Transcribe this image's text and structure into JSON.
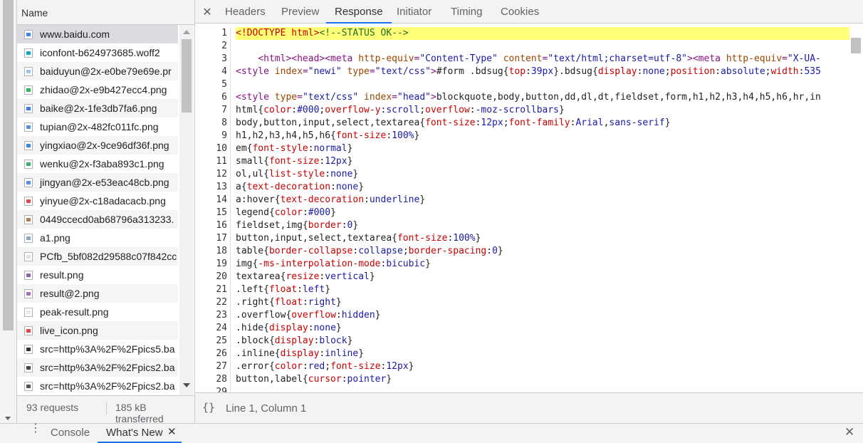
{
  "network": {
    "header": "Name",
    "rows": [
      {
        "name": "www.baidu.com",
        "icon": "document-icon",
        "color": "#4285f4",
        "bg": "sel"
      },
      {
        "name": "iconfont-b624973685.woff2",
        "icon": "font-icon",
        "color": "#12a5c4",
        "bg": ""
      },
      {
        "name": "baiduyun@2x-e0be79e69e.pr",
        "icon": "image-icon",
        "color": "#9dc3ea",
        "bg": "alt"
      },
      {
        "name": "zhidao@2x-e9b427ecc4.png",
        "icon": "image-icon",
        "color": "#2fb75b",
        "bg": ""
      },
      {
        "name": "baike@2x-1fe3db7fa6.png",
        "icon": "image-icon",
        "color": "#3c7dea",
        "bg": "alt"
      },
      {
        "name": "tupian@2x-482fc011fc.png",
        "icon": "image-icon",
        "color": "#5a8ed8",
        "bg": ""
      },
      {
        "name": "yingxiao@2x-9ce96df36f.png",
        "icon": "image-icon",
        "color": "#3d84f0",
        "bg": "alt"
      },
      {
        "name": "wenku@2x-f3aba893c1.png",
        "icon": "image-icon",
        "color": "#3fae68",
        "bg": ""
      },
      {
        "name": "jingyan@2x-e53eac48cb.png",
        "icon": "image-icon",
        "color": "#5b8fe5",
        "bg": "alt"
      },
      {
        "name": "yinyue@2x-c18adacacb.png",
        "icon": "image-icon",
        "color": "#e5484d",
        "bg": ""
      },
      {
        "name": "0449ccecd0ab68796a313233.",
        "icon": "image-icon",
        "color": "#b07c5a",
        "bg": "alt"
      },
      {
        "name": "a1.png",
        "icon": "image-icon",
        "color": "#8aa5c9",
        "bg": ""
      },
      {
        "name": "PCfb_5bf082d29588c07f842cc",
        "icon": "image-icon",
        "color": "#dfe3e8",
        "bg": "alt"
      },
      {
        "name": "result.png",
        "icon": "image-icon",
        "color": "#8c6aa8",
        "bg": ""
      },
      {
        "name": "result@2.png",
        "icon": "image-icon",
        "color": "#a574b8",
        "bg": "alt"
      },
      {
        "name": "peak-result.png",
        "icon": "image-icon",
        "color": "#e8e8e8",
        "bg": ""
      },
      {
        "name": "live_icon.png",
        "icon": "image-icon",
        "color": "#e54545",
        "bg": "alt"
      },
      {
        "name": "src=http%3A%2F%2Fpics5.ba",
        "icon": "image-icon",
        "color": "#333333",
        "bg": ""
      },
      {
        "name": "src=http%3A%2F%2Fpics2.ba",
        "icon": "image-icon",
        "color": "#444444",
        "bg": "alt"
      },
      {
        "name": "src=http%3A%2F%2Fpics2.ba",
        "icon": "image-icon",
        "color": "#555555",
        "bg": ""
      }
    ],
    "footer_requests": "93 requests",
    "footer_transferred": "185 kB transferred"
  },
  "tabs": [
    "Headers",
    "Preview",
    "Response",
    "Initiator",
    "Timing",
    "Cookies"
  ],
  "active_tab": "Response",
  "code_lines": [
    [
      [
        "dt",
        "<!DOCTYPE html>"
      ],
      [
        "cm",
        "<!--STATUS OK-->"
      ]
    ],
    [],
    [
      [
        "pl",
        "    "
      ],
      [
        "tg",
        "<html><head><meta "
      ],
      [
        "at",
        "http-equiv"
      ],
      [
        "tg",
        "="
      ],
      [
        "av",
        "\"Content-Type\""
      ],
      [
        "tg",
        " "
      ],
      [
        "at",
        "content"
      ],
      [
        "tg",
        "="
      ],
      [
        "av",
        "\"text/html;charset=utf-8\""
      ],
      [
        "tg",
        "><meta "
      ],
      [
        "at",
        "http-equiv"
      ],
      [
        "tg",
        "="
      ],
      [
        "av",
        "\"X-UA-"
      ]
    ],
    [
      [
        "tg",
        "<style "
      ],
      [
        "at",
        "index"
      ],
      [
        "tg",
        "="
      ],
      [
        "av",
        "\"newi\""
      ],
      [
        "tg",
        " "
      ],
      [
        "at",
        "type"
      ],
      [
        "tg",
        "="
      ],
      [
        "av",
        "\"text/css\""
      ],
      [
        "tg",
        ">"
      ],
      [
        "pl",
        "#form .bdsug{"
      ],
      [
        "pr",
        "top"
      ],
      [
        "pl",
        ":"
      ],
      [
        "vl",
        "39px"
      ],
      [
        "pl",
        "}.bdsug{"
      ],
      [
        "pr",
        "display"
      ],
      [
        "pl",
        ":"
      ],
      [
        "vl",
        "none"
      ],
      [
        "pl",
        ";"
      ],
      [
        "pr",
        "position"
      ],
      [
        "pl",
        ":"
      ],
      [
        "vl",
        "absolute"
      ],
      [
        "pl",
        ";"
      ],
      [
        "pr",
        "width"
      ],
      [
        "pl",
        ":"
      ],
      [
        "vl",
        "535"
      ]
    ],
    [],
    [
      [
        "tg",
        "<style "
      ],
      [
        "at",
        "type"
      ],
      [
        "tg",
        "="
      ],
      [
        "av",
        "\"text/css\""
      ],
      [
        "tg",
        " "
      ],
      [
        "at",
        "index"
      ],
      [
        "tg",
        "="
      ],
      [
        "av",
        "\"head\""
      ],
      [
        "tg",
        ">"
      ],
      [
        "pl",
        "blockquote,body,button,dd,dl,dt,fieldset,form,h1,h2,h3,h4,h5,h6,hr,in"
      ]
    ],
    [
      [
        "pl",
        "html{"
      ],
      [
        "pr",
        "color"
      ],
      [
        "pl",
        ":"
      ],
      [
        "vl",
        "#000"
      ],
      [
        "pl",
        ";"
      ],
      [
        "pr",
        "overflow-y"
      ],
      [
        "pl",
        ":"
      ],
      [
        "vl",
        "scroll"
      ],
      [
        "pl",
        ";"
      ],
      [
        "pr",
        "overflow"
      ],
      [
        "pl",
        ":"
      ],
      [
        "vl",
        "-moz-scrollbars"
      ],
      [
        "pl",
        "}"
      ]
    ],
    [
      [
        "pl",
        "body,button,input,select,textarea{"
      ],
      [
        "pr",
        "font-size"
      ],
      [
        "pl",
        ":"
      ],
      [
        "vl",
        "12px"
      ],
      [
        "pl",
        ";"
      ],
      [
        "pr",
        "font-family"
      ],
      [
        "pl",
        ":"
      ],
      [
        "vl",
        "Arial"
      ],
      [
        "pl",
        ","
      ],
      [
        "vl",
        "sans-serif"
      ],
      [
        "pl",
        "}"
      ]
    ],
    [
      [
        "pl",
        "h1,h2,h3,h4,h5,h6{"
      ],
      [
        "pr",
        "font-size"
      ],
      [
        "pl",
        ":"
      ],
      [
        "vl",
        "100%"
      ],
      [
        "pl",
        "}"
      ]
    ],
    [
      [
        "pl",
        "em{"
      ],
      [
        "pr",
        "font-style"
      ],
      [
        "pl",
        ":"
      ],
      [
        "vl",
        "normal"
      ],
      [
        "pl",
        "}"
      ]
    ],
    [
      [
        "pl",
        "small{"
      ],
      [
        "pr",
        "font-size"
      ],
      [
        "pl",
        ":"
      ],
      [
        "vl",
        "12px"
      ],
      [
        "pl",
        "}"
      ]
    ],
    [
      [
        "pl",
        "ol,ul{"
      ],
      [
        "pr",
        "list-style"
      ],
      [
        "pl",
        ":"
      ],
      [
        "vl",
        "none"
      ],
      [
        "pl",
        "}"
      ]
    ],
    [
      [
        "pl",
        "a{"
      ],
      [
        "pr",
        "text-decoration"
      ],
      [
        "pl",
        ":"
      ],
      [
        "vl",
        "none"
      ],
      [
        "pl",
        "}"
      ]
    ],
    [
      [
        "pl",
        "a:hover{"
      ],
      [
        "pr",
        "text-decoration"
      ],
      [
        "pl",
        ":"
      ],
      [
        "vl",
        "underline"
      ],
      [
        "pl",
        "}"
      ]
    ],
    [
      [
        "pl",
        "legend{"
      ],
      [
        "pr",
        "color"
      ],
      [
        "pl",
        ":"
      ],
      [
        "vl",
        "#000"
      ],
      [
        "pl",
        "}"
      ]
    ],
    [
      [
        "pl",
        "fieldset,img{"
      ],
      [
        "pr",
        "border"
      ],
      [
        "pl",
        ":"
      ],
      [
        "vl",
        "0"
      ],
      [
        "pl",
        "}"
      ]
    ],
    [
      [
        "pl",
        "button,input,select,textarea{"
      ],
      [
        "pr",
        "font-size"
      ],
      [
        "pl",
        ":"
      ],
      [
        "vl",
        "100%"
      ],
      [
        "pl",
        "}"
      ]
    ],
    [
      [
        "pl",
        "table{"
      ],
      [
        "pr",
        "border-collapse"
      ],
      [
        "pl",
        ":"
      ],
      [
        "vl",
        "collapse"
      ],
      [
        "pl",
        ";"
      ],
      [
        "pr",
        "border-spacing"
      ],
      [
        "pl",
        ":"
      ],
      [
        "vl",
        "0"
      ],
      [
        "pl",
        "}"
      ]
    ],
    [
      [
        "pl",
        "img{"
      ],
      [
        "pr",
        "-ms-interpolation-mode"
      ],
      [
        "pl",
        ":"
      ],
      [
        "vl",
        "bicubic"
      ],
      [
        "pl",
        "}"
      ]
    ],
    [
      [
        "pl",
        "textarea{"
      ],
      [
        "pr",
        "resize"
      ],
      [
        "pl",
        ":"
      ],
      [
        "vl",
        "vertical"
      ],
      [
        "pl",
        "}"
      ]
    ],
    [
      [
        "pl",
        ".left{"
      ],
      [
        "pr",
        "float"
      ],
      [
        "pl",
        ":"
      ],
      [
        "vl",
        "left"
      ],
      [
        "pl",
        "}"
      ]
    ],
    [
      [
        "pl",
        ".right{"
      ],
      [
        "pr",
        "float"
      ],
      [
        "pl",
        ":"
      ],
      [
        "vl",
        "right"
      ],
      [
        "pl",
        "}"
      ]
    ],
    [
      [
        "pl",
        ".overflow{"
      ],
      [
        "pr",
        "overflow"
      ],
      [
        "pl",
        ":"
      ],
      [
        "vl",
        "hidden"
      ],
      [
        "pl",
        "}"
      ]
    ],
    [
      [
        "pl",
        ".hide{"
      ],
      [
        "pr",
        "display"
      ],
      [
        "pl",
        ":"
      ],
      [
        "vl",
        "none"
      ],
      [
        "pl",
        "}"
      ]
    ],
    [
      [
        "pl",
        ".block{"
      ],
      [
        "pr",
        "display"
      ],
      [
        "pl",
        ":"
      ],
      [
        "vl",
        "block"
      ],
      [
        "pl",
        "}"
      ]
    ],
    [
      [
        "pl",
        ".inline{"
      ],
      [
        "pr",
        "display"
      ],
      [
        "pl",
        ":"
      ],
      [
        "vl",
        "inline"
      ],
      [
        "pl",
        "}"
      ]
    ],
    [
      [
        "pl",
        ".error{"
      ],
      [
        "pr",
        "color"
      ],
      [
        "pl",
        ":"
      ],
      [
        "vl",
        "red"
      ],
      [
        "pl",
        ";"
      ],
      [
        "pr",
        "font-size"
      ],
      [
        "pl",
        ":"
      ],
      [
        "vl",
        "12px"
      ],
      [
        "pl",
        "}"
      ]
    ],
    [
      [
        "pl",
        "button,label{"
      ],
      [
        "pr",
        "cursor"
      ],
      [
        "pl",
        ":"
      ],
      [
        "vl",
        "pointer"
      ],
      [
        "pl",
        "}"
      ]
    ],
    []
  ],
  "status": {
    "braces": "{}",
    "position": "Line 1, Column 1"
  },
  "drawer": {
    "tabs": [
      "Console",
      "What's New"
    ],
    "active": "What's New",
    "close_tab": "✕",
    "close_drawer": "✕"
  },
  "tab_close": "✕",
  "menu_glyph": "⋮"
}
